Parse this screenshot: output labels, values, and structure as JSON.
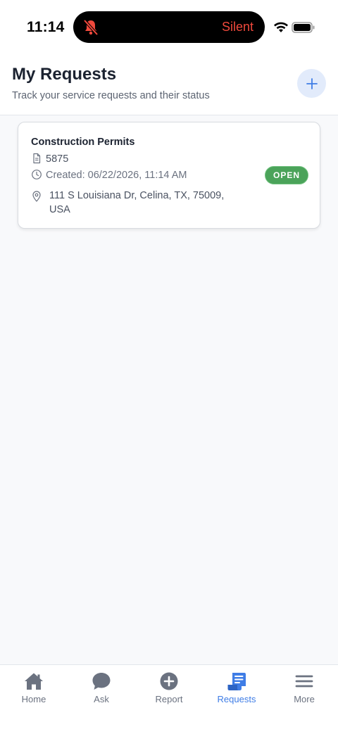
{
  "status_bar": {
    "time": "11:14",
    "silent_label": "Silent"
  },
  "header": {
    "title": "My Requests",
    "subtitle": "Track your service requests and their status",
    "add_icon": "plus-icon"
  },
  "requests": [
    {
      "category": "Construction Permits",
      "id": "5875",
      "created": "Created: 06/22/2026, 11:14 AM",
      "address": "111 S Louisiana Dr, Celina, TX, 75009, USA",
      "status": "OPEN"
    }
  ],
  "tabs": [
    {
      "label": "Home",
      "icon": "home-icon",
      "active": false
    },
    {
      "label": "Ask",
      "icon": "chat-bubble-icon",
      "active": false
    },
    {
      "label": "Report",
      "icon": "plus-circle-icon",
      "active": false
    },
    {
      "label": "Requests",
      "icon": "requests-scroll-icon",
      "active": true
    },
    {
      "label": "More",
      "icon": "menu-icon",
      "active": false
    }
  ],
  "colors": {
    "accent": "#3f7de6",
    "status_open": "#4ba35a",
    "silent_red": "#f0493c",
    "tab_inactive": "#6b7280"
  }
}
